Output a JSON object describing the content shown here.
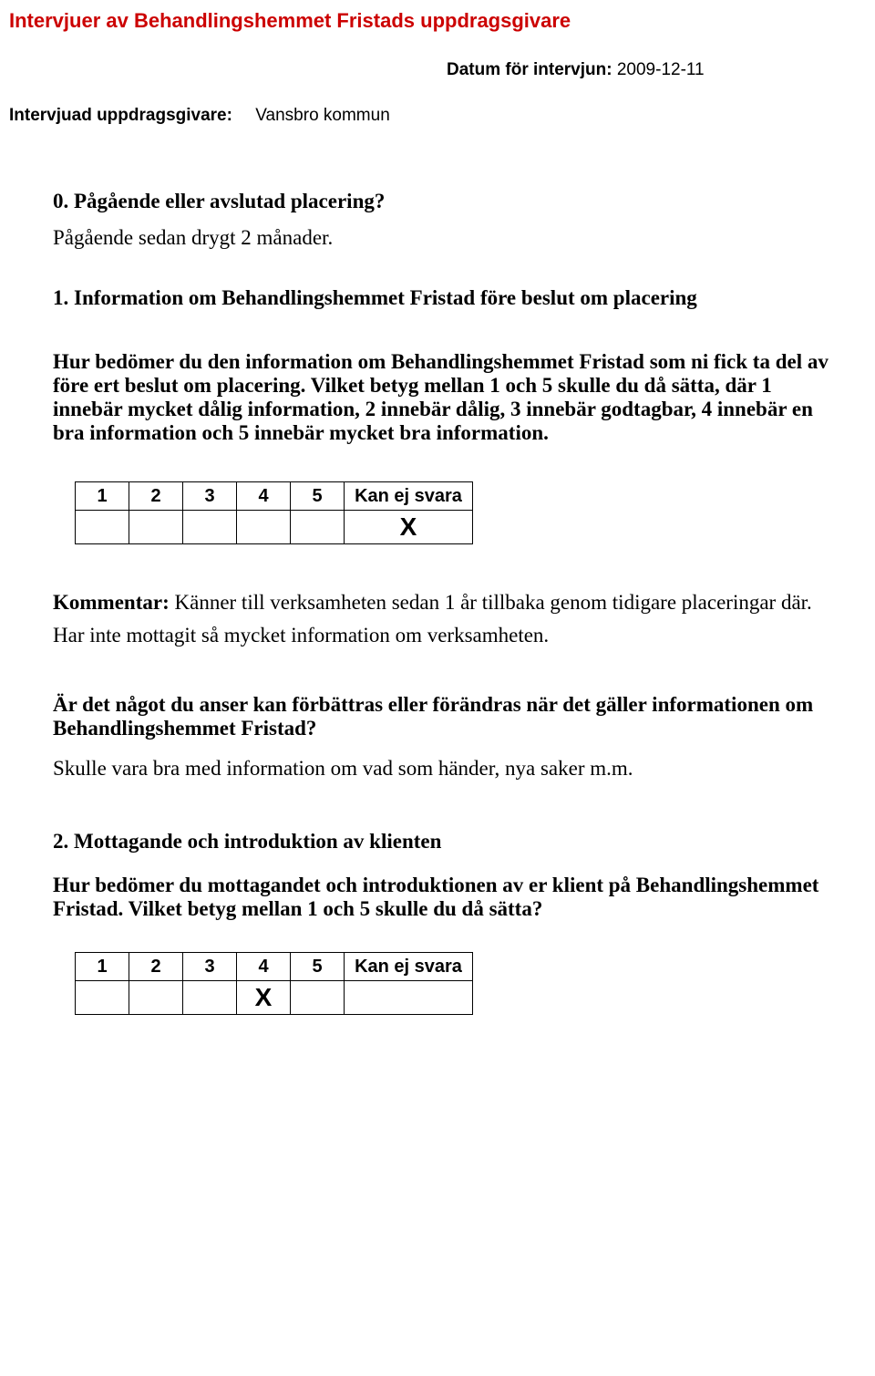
{
  "header": {
    "title": "Intervjuer av Behandlingshemmet Fristads uppdragsgivare",
    "date_label": "Datum för intervjun:",
    "date_value": "2009-12-11",
    "interviewee_label": "Intervjuad uppdragsgivare:",
    "interviewee_value": "Vansbro kommun"
  },
  "q0": {
    "title": "0.  Pågående eller avslutad placering?",
    "answer": "Pågående sedan drygt 2 månader."
  },
  "q1": {
    "heading": "1.  Information om Behandlingshemmet Fristad före beslut om placering",
    "body": "Hur bedömer du den information om Behandlingshemmet Fristad som ni fick ta del av före ert beslut om placering. Vilket betyg mellan 1 och 5 skulle du då sätta, där 1 innebär mycket dålig information, 2 innebär dålig, 3 innebär godtagbar, 4 innebär en bra information och 5 innebär mycket bra information.",
    "scale": {
      "c1": "1",
      "c2": "2",
      "c3": "3",
      "c4": "4",
      "c5": "5",
      "kan": "Kan ej svara"
    },
    "answer_col": 6,
    "answer_mark": "X",
    "comment_label": "Kommentar:",
    "comment_text": "Känner till verksamheten sedan 1 år tillbaka genom tidigare placeringar där. Har inte mottagit så mycket information om verksamheten.",
    "followup_q": "Är det något du anser kan förbättras eller förändras när det gäller informationen om Behandlingshemmet Fristad?",
    "followup_a": "Skulle vara bra med information om vad som händer, nya saker m.m."
  },
  "q2": {
    "heading": "2.  Mottagande och introduktion av klienten",
    "body": "Hur bedömer du mottagandet och introduktionen av er klient på Behandlingshemmet Fristad. Vilket betyg mellan 1 och 5 skulle du då sätta?",
    "scale": {
      "c1": "1",
      "c2": "2",
      "c3": "3",
      "c4": "4",
      "c5": "5",
      "kan": "Kan ej svara"
    },
    "answer_col": 4,
    "answer_mark": "X"
  }
}
